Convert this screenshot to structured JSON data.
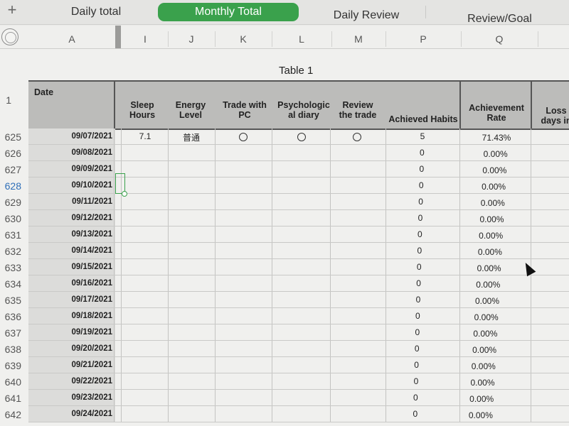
{
  "sheet_tabs": [
    {
      "label": "Daily total",
      "active": false
    },
    {
      "label": "Monthly Total",
      "active": true
    },
    {
      "label": "Daily Review",
      "active": false
    },
    {
      "label": "Review/Goal",
      "active": false
    }
  ],
  "column_letters": [
    "A",
    "I",
    "J",
    "K",
    "L",
    "M",
    "P",
    "Q"
  ],
  "table_title": "Table 1",
  "header_row_number": "1",
  "headers": {
    "date": "Date",
    "sleep": [
      "Sleep",
      "Hours"
    ],
    "energy": [
      "Energy",
      "Level"
    ],
    "trade": [
      "Trade with",
      "PC"
    ],
    "psych": [
      "Psychologic",
      "al diary"
    ],
    "review": [
      "Review",
      "the trade"
    ],
    "habits": "Achieved Habits",
    "rate": [
      "Achievement",
      "Rate"
    ],
    "loss": [
      "Loss",
      "days in"
    ]
  },
  "rows": [
    {
      "num": "625",
      "date": "09/07/2021",
      "sleep": "7.1",
      "energy": "普通",
      "trade": true,
      "psych": true,
      "review": true,
      "habits": "5",
      "rate": "71.43%"
    },
    {
      "num": "626",
      "date": "09/08/2021",
      "habits": "0",
      "rate": "0.00%"
    },
    {
      "num": "627",
      "date": "09/09/2021",
      "habits": "0",
      "rate": "0.00%"
    },
    {
      "num": "628",
      "date": "09/10/2021",
      "habits": "0",
      "rate": "0.00%",
      "selected": true
    },
    {
      "num": "629",
      "date": "09/11/2021",
      "habits": "0",
      "rate": "0.00%"
    },
    {
      "num": "630",
      "date": "09/12/2021",
      "habits": "0",
      "rate": "0.00%"
    },
    {
      "num": "631",
      "date": "09/13/2021",
      "habits": "0",
      "rate": "0.00%"
    },
    {
      "num": "632",
      "date": "09/14/2021",
      "habits": "0",
      "rate": "0.00%"
    },
    {
      "num": "633",
      "date": "09/15/2021",
      "habits": "0",
      "rate": "0.00%"
    },
    {
      "num": "634",
      "date": "09/16/2021",
      "habits": "0",
      "rate": "0.00%"
    },
    {
      "num": "635",
      "date": "09/17/2021",
      "habits": "0",
      "rate": "0.00%"
    },
    {
      "num": "636",
      "date": "09/18/2021",
      "habits": "0",
      "rate": "0.00%"
    },
    {
      "num": "637",
      "date": "09/19/2021",
      "habits": "0",
      "rate": "0.00%"
    },
    {
      "num": "638",
      "date": "09/20/2021",
      "habits": "0",
      "rate": "0.00%"
    },
    {
      "num": "639",
      "date": "09/21/2021",
      "habits": "0",
      "rate": "0.00%"
    },
    {
      "num": "640",
      "date": "09/22/2021",
      "habits": "0",
      "rate": "0.00%"
    },
    {
      "num": "641",
      "date": "09/23/2021",
      "habits": "0",
      "rate": "0.00%"
    },
    {
      "num": "642",
      "date": "09/24/2021",
      "habits": "0",
      "rate": "0.00%"
    }
  ],
  "colors": {
    "active_tab": "#3aa14c",
    "header_fill": "#bcbcba",
    "selection": "#3aa14c"
  },
  "icons": {
    "add_sheet": "plus-icon",
    "select_all": "circle-select-icon",
    "habit_mark": "circle-icon",
    "pointer": "mouse-cursor-icon"
  }
}
